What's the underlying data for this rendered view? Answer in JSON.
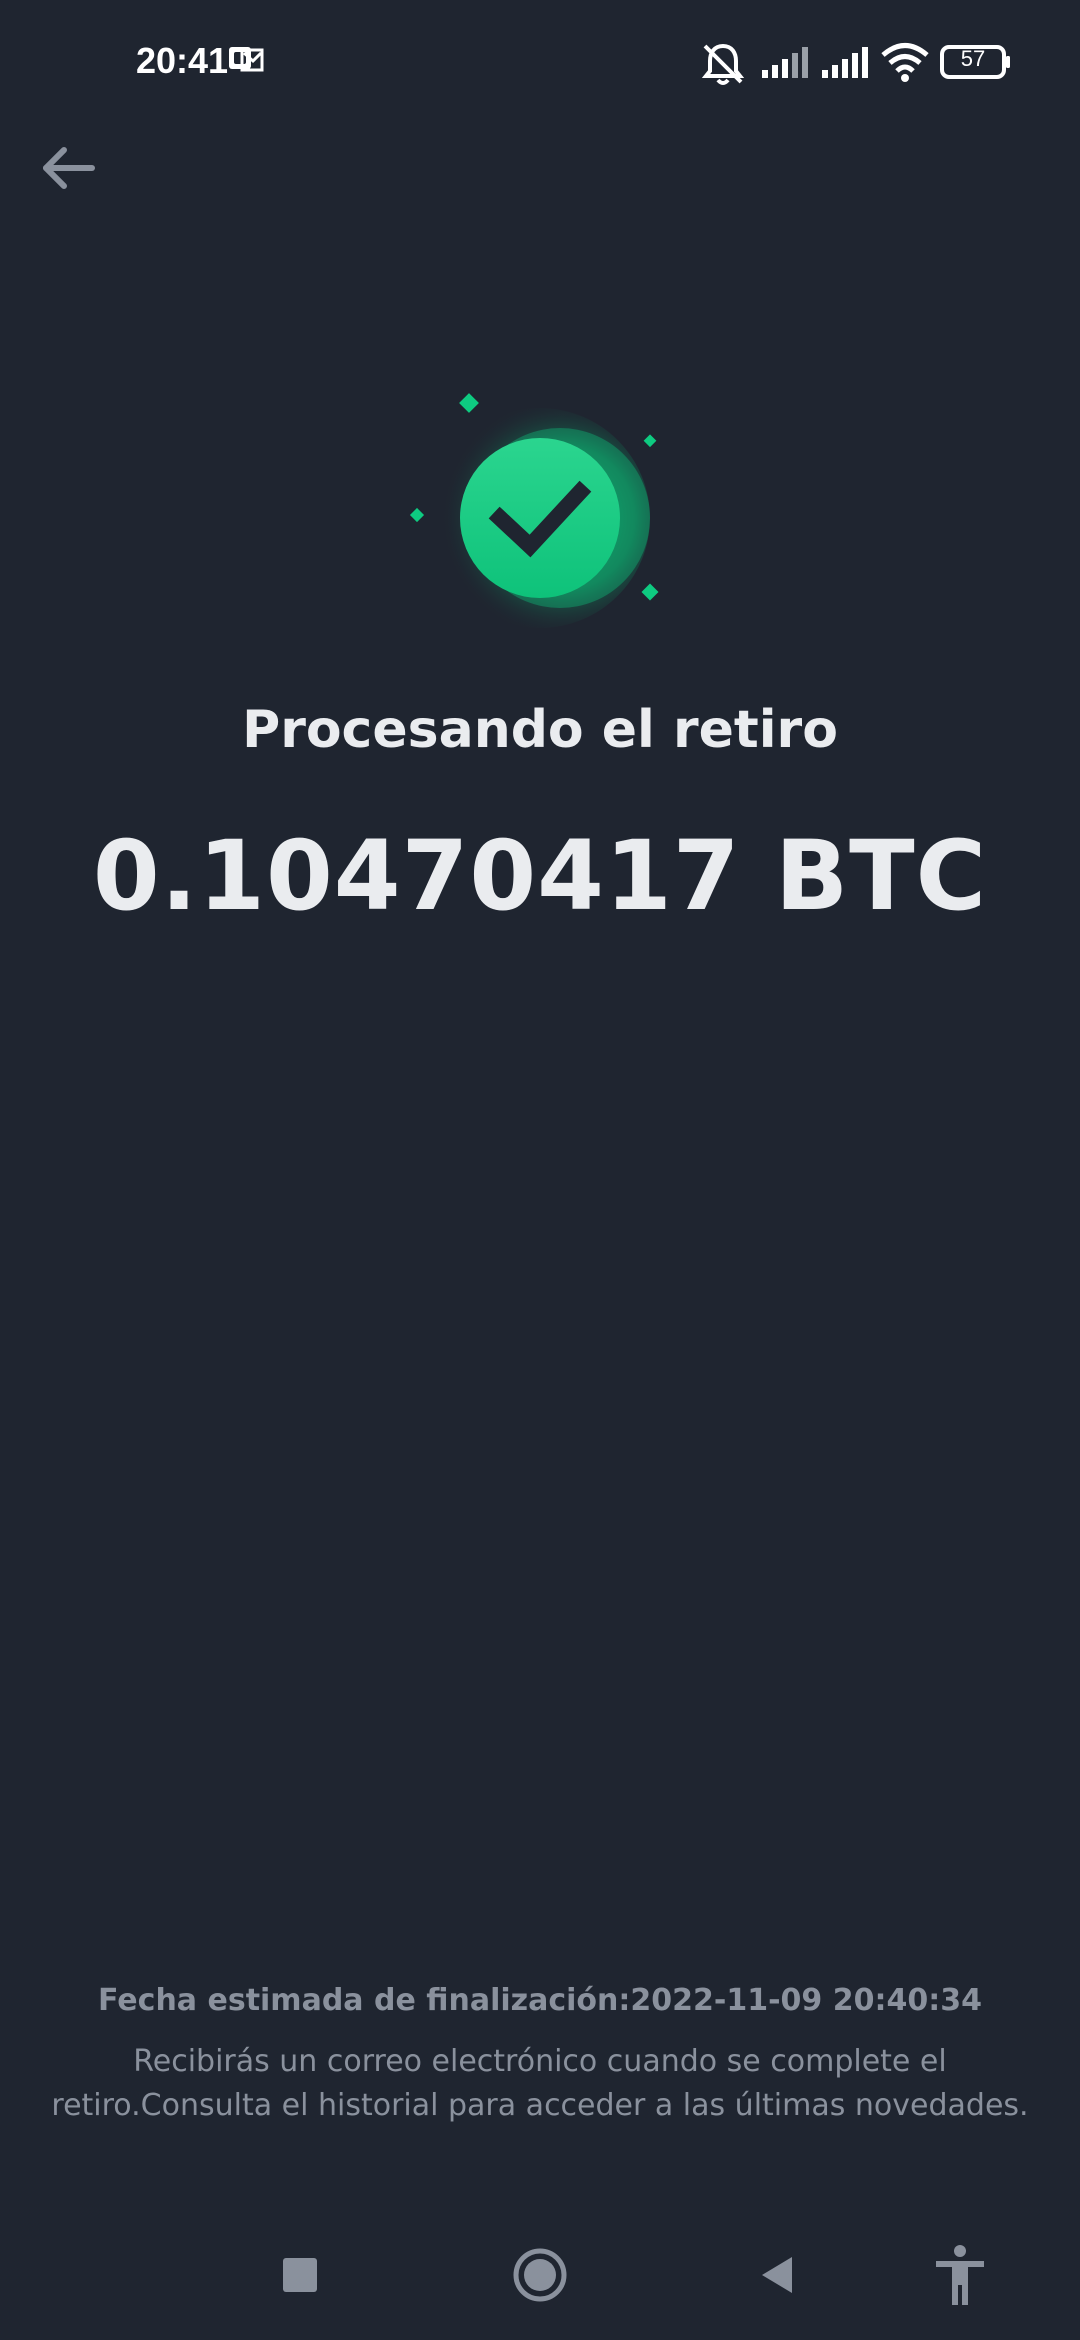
{
  "status_bar": {
    "time": "20:41",
    "battery_level": "57",
    "icons": [
      "notification-icon",
      "mute-icon",
      "signal-icon",
      "signal-icon",
      "wifi-icon",
      "battery-icon"
    ]
  },
  "header": {
    "back_icon": "arrow-left-icon"
  },
  "main": {
    "title": "Procesando el retiro",
    "amount": "0.10470417 BTC",
    "status_icon": "check-circle-icon"
  },
  "footer": {
    "estimated_date": "Fecha estimada de finalización:2022-11-09 20:40:34",
    "info": "Recibirás un correo electrónico cuando se complete el retiro.Consulta el historial para acceder a las últimas novedades."
  },
  "nav": {
    "buttons": [
      "recents-icon",
      "home-icon",
      "back-icon",
      "accessibility-icon"
    ]
  },
  "colors": {
    "background": "#1f2530",
    "accent_green": "#0ecb81",
    "text_primary": "#eaecef",
    "text_secondary": "#8a919d"
  }
}
